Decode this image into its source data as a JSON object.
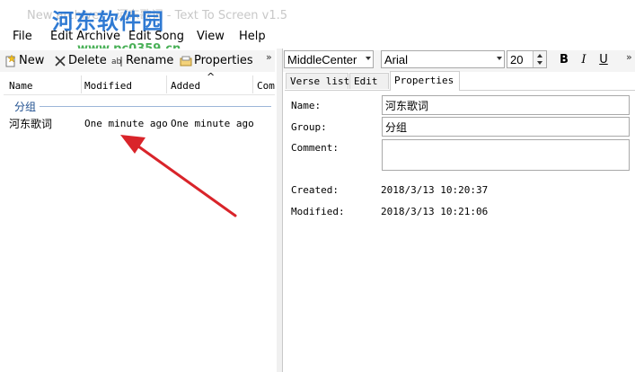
{
  "window": {
    "title": "New archive* - 河东歌词 - Text To Screen v1.5",
    "watermark_logo": "河东软件园",
    "watermark_url": "www.pc0359.cn"
  },
  "menu": [
    "File",
    "Edit Archive",
    "Edit Song",
    "View",
    "Help"
  ],
  "left_toolbar": {
    "new_label": "New",
    "delete_label": "Delete",
    "rename_label": "Rename",
    "properties_label": "Properties",
    "overflow": "»"
  },
  "song_list": {
    "columns": [
      "Name",
      "Modified",
      "Added",
      "Com"
    ],
    "sort_indicator": "^",
    "group_name": "分组",
    "rows": [
      {
        "name": "河东歌词",
        "modified": "One minute ago",
        "added": "One minute ago"
      }
    ]
  },
  "right_toolbar": {
    "alignment_value": "MiddleCenter",
    "font_value": "Arial",
    "size_value": "20",
    "bold_label": "B",
    "italic_label": "I",
    "underline_label": "U",
    "overflow": "»"
  },
  "tabs": [
    "Verse list",
    "Edit",
    "Properties"
  ],
  "active_tab": "Properties",
  "properties": {
    "name_label": "Name:",
    "name_value": "河东歌词",
    "group_label": "Group:",
    "group_value": "分组",
    "comment_label": "Comment:",
    "comment_value": "",
    "created_label": "Created:",
    "created_value": "2018/3/13 10:20:37",
    "modified_label": "Modified:",
    "modified_value": "2018/3/13 10:21:06"
  },
  "colors": {
    "annotation_arrow": "#d9242a",
    "group_text": "#1f4f8f",
    "watermark_logo": "#1e6fd0",
    "watermark_url": "#2aa33a"
  }
}
